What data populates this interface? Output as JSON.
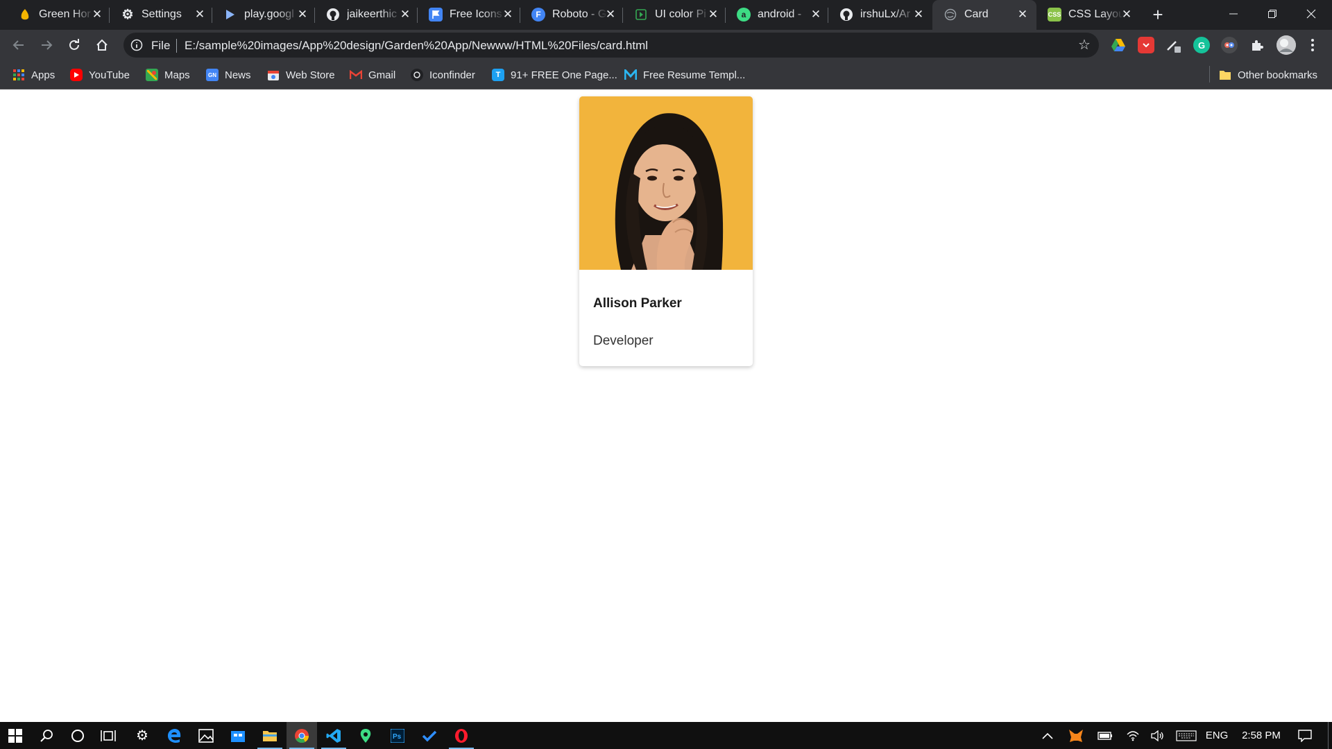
{
  "browser": {
    "tabs": [
      {
        "title": "Green Hor",
        "icon": "green-house-icon",
        "color": "#f4b400"
      },
      {
        "title": "Settings",
        "icon": "gear-icon",
        "color": "#e8eaed"
      },
      {
        "title": "play.googl",
        "icon": "play-store-icon",
        "color": "#8ab4f8"
      },
      {
        "title": "jaikeerthic",
        "icon": "github-icon",
        "color": "#e8eaed"
      },
      {
        "title": "Free Icons",
        "icon": "flag-icon",
        "color": "#4285f4"
      },
      {
        "title": "Roboto - G",
        "icon": "google-fonts-icon",
        "color": "#4285f4"
      },
      {
        "title": "UI color Pi",
        "icon": "play-icon",
        "color": "#34a853"
      },
      {
        "title": "android - ",
        "icon": "android-icon",
        "color": "#3ddc84"
      },
      {
        "title": "irshuLx/Ar",
        "icon": "github-icon",
        "color": "#e8eaed"
      },
      {
        "title": "Card",
        "icon": "globe-icon",
        "color": "#9aa0a6",
        "active": true
      },
      {
        "title": "CSS Layou",
        "icon": "css-icon",
        "color": "#8bc34a"
      }
    ],
    "new_tab_label": "+",
    "scheme_label": "File",
    "url": "E:/sample%20images/App%20design/Garden%20App/Newww/HTML%20Files/card.html",
    "bookmarks": [
      {
        "label": "Apps",
        "icon": "apps-grid-icon",
        "color": "#ea4335"
      },
      {
        "label": "YouTube",
        "icon": "youtube-icon",
        "color": "#ff0000"
      },
      {
        "label": "Maps",
        "icon": "maps-icon",
        "color": "#34a853"
      },
      {
        "label": "News",
        "icon": "google-news-icon",
        "color": "#4285f4"
      },
      {
        "label": "Web Store",
        "icon": "web-store-icon",
        "color": "#ea4335"
      },
      {
        "label": "Gmail",
        "icon": "gmail-icon",
        "color": "#ea4335"
      },
      {
        "label": "Iconfinder",
        "icon": "iconfinder-icon",
        "color": "#e8eaed"
      },
      {
        "label": "91+ FREE One Page...",
        "icon": "t-icon",
        "color": "#1da1f2"
      },
      {
        "label": "Free Resume Templ...",
        "icon": "m-icon",
        "color": "#2bb6f1"
      }
    ],
    "other_bookmarks_label": "Other bookmarks"
  },
  "card": {
    "name": "Allison Parker",
    "role": "Developer",
    "photo_bg": "#f2b43c"
  },
  "taskbar": {
    "language": "ENG",
    "time": "2:58 PM"
  }
}
